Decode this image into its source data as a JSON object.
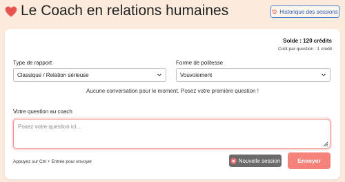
{
  "header": {
    "title": "Le Coach en relations humaines",
    "history_button": "Historique des sessions",
    "heart_icon": "heart-icon",
    "history_icon": "history-icon"
  },
  "balance": {
    "solde": "Solde : 120 crédits",
    "cost": "Coût par question : 1 crédit"
  },
  "form": {
    "relation_label": "Type de rapport",
    "relation_value": "Classique / Relation sérieuse",
    "politeness_label": "Forme de politesse",
    "politeness_value": "Vouvoiement"
  },
  "empty_message": "Aucune conversation pour le moment. Posez votre première question !",
  "question": {
    "label": "Votre question au coach",
    "placeholder": "Posez votre question ici..."
  },
  "footer": {
    "hint": "Appuyez sur Ctrl + Entrée pour envoyer",
    "new_session": "Nouvelle session",
    "send": "Envoyer"
  },
  "colors": {
    "accent": "#f5837c",
    "background": "#fcebdc",
    "link": "#2a5bb8"
  }
}
